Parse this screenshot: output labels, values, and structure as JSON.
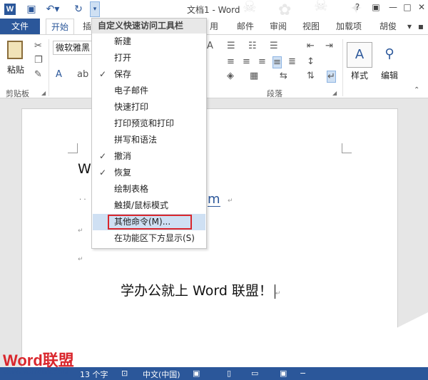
{
  "titlebar": {
    "title": "文档1 - Word",
    "help_label": "?",
    "minimize_label": "—",
    "restore_label": "□",
    "close_label": "✕",
    "undo_icon": "undo-icon",
    "redo_icon": "redo-icon",
    "save_icon": "save-icon"
  },
  "tabs": {
    "file": "文件",
    "home": "开始",
    "insert": "插",
    "references": "用",
    "mailings": "邮件",
    "review": "审阅",
    "view": "视图",
    "addins": "加载项",
    "user": "胡俊"
  },
  "ribbon": {
    "paste_label": "粘贴",
    "clipboard_group": "剪贴板",
    "font_name": "微软雅黑",
    "paragraph_group": "段落",
    "styles_label": "样式",
    "editing_label": "编辑"
  },
  "menu": {
    "header": "自定义快速访问工具栏",
    "items": [
      {
        "label": "新建",
        "checked": false
      },
      {
        "label": "打开",
        "checked": false
      },
      {
        "label": "保存",
        "checked": true
      },
      {
        "label": "电子邮件",
        "checked": false
      },
      {
        "label": "快速打印",
        "checked": false
      },
      {
        "label": "打印预览和打印",
        "checked": false
      },
      {
        "label": "拼写和语法",
        "checked": false
      },
      {
        "label": "撤消",
        "checked": true
      },
      {
        "label": "恢复",
        "checked": true
      },
      {
        "label": "绘制表格",
        "checked": false
      },
      {
        "label": "触摸/鼠标模式",
        "checked": false
      },
      {
        "label": "其他命令(M)...",
        "checked": false,
        "highlighted": true
      },
      {
        "label": "在功能区下方显示(S)",
        "checked": false
      }
    ]
  },
  "document": {
    "main_text": "学办公就上 Word 联盟！",
    "partial_w": "W",
    "partial_m": "m"
  },
  "statusbar": {
    "word_count": "13 个字",
    "language": "中文(中国)"
  },
  "watermark": {
    "brand": "Word联盟",
    "url": "www.wordlm.com"
  },
  "colors": {
    "accent": "#2b579a",
    "highlight_border": "#d9262c",
    "menu_highlight": "#cfe0f3"
  }
}
